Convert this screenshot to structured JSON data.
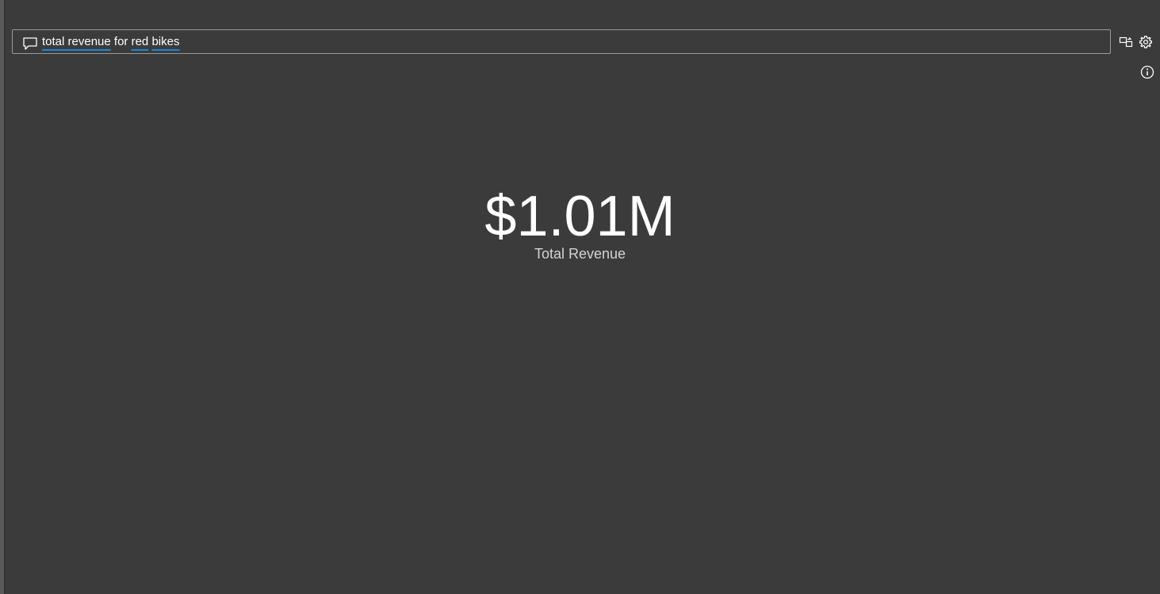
{
  "qa": {
    "query_parts": [
      "total revenue",
      "for",
      "red",
      "bikes"
    ]
  },
  "kpi": {
    "value": "$1.01M",
    "label": "Total Revenue"
  },
  "icons": {
    "qa": "chat-bubble-icon",
    "convert": "turn-into-visual-icon",
    "settings": "gear-icon",
    "info": "info-icon"
  },
  "colors": {
    "background": "#3b3b3b",
    "text": "#ffffff",
    "underline_accent": "#1a86d9",
    "border": "#9a9a9a"
  }
}
